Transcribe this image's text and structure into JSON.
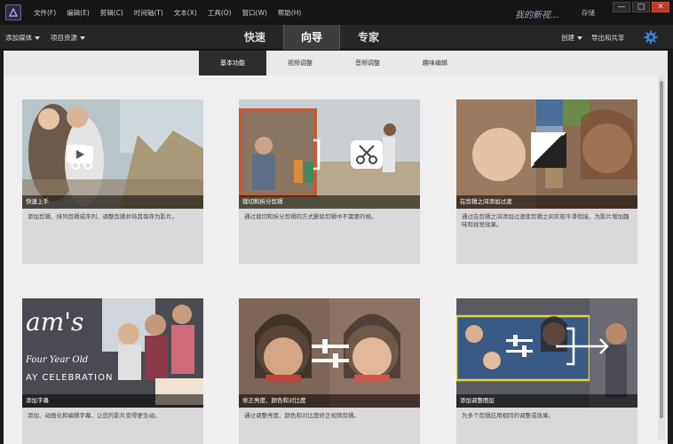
{
  "menu": [
    "文件(F)",
    "编辑(E)",
    "剪辑(C)",
    "时间轴(T)",
    "文本(X)",
    "工具(O)",
    "窗口(W)",
    "帮助(H)"
  ],
  "project_name": "我的新视...",
  "save_label": "存储",
  "window_controls": [
    "—",
    "□",
    "✕"
  ],
  "toolbar": {
    "add_media": "添加媒体",
    "project_assets": "项目资源",
    "modes": [
      "快速",
      "向导",
      "专家"
    ],
    "active_mode": "向导",
    "create": "创建",
    "export_share": "导出和共享"
  },
  "subtabs": [
    "基本功能",
    "视频调整",
    "音频调整",
    "趣味编辑"
  ],
  "active_subtab": "基本功能",
  "cards": [
    {
      "title": "快速上手",
      "desc": "添加剪辑、排列剪辑成序列、调整剪辑并将其保存为影片。"
    },
    {
      "title": "裁切和拆分剪辑",
      "desc": "通过裁切和拆分剪辑的方式删除剪辑中不需要的帧。"
    },
    {
      "title": "在剪辑之间添加过渡",
      "desc": "通过在剪辑之间添加过渡使剪辑之间实现平滑衔接，为影片增加趣味和视觉效果。"
    },
    {
      "title": "添加字幕",
      "desc": "添加、动画化和编辑字幕，让您的影片变得更生动。"
    },
    {
      "title": "修正亮度、颜色和对比度",
      "desc": "通过调整亮度、颜色和对比度修正视频剪辑。"
    },
    {
      "title": "添加调整图层",
      "desc": "为多个剪辑应用相同的调整或效果。"
    }
  ],
  "card4_overlay_text": [
    "am's",
    "Four Year Old",
    "AY CELEBRATION"
  ],
  "colors": {
    "accent": "#3a86d6",
    "close": "#c0392b",
    "frame_orange": "#d0552a",
    "frame_yellow": "#e4d43a"
  }
}
